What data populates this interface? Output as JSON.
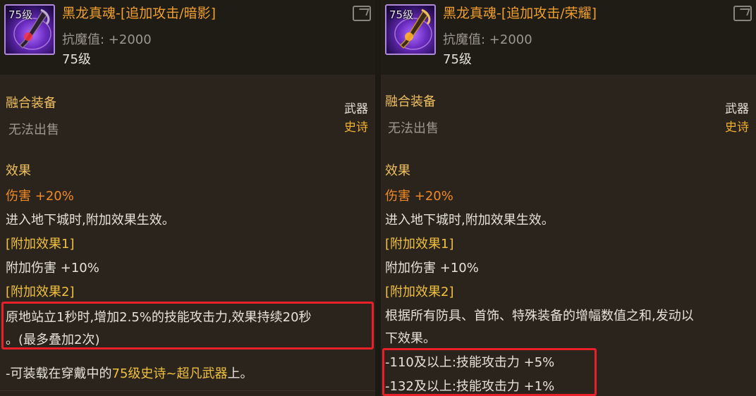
{
  "colors": {
    "accent_orange": "#f0a030",
    "red_highlight": "#e8202a",
    "epic_gold": "#f0b030"
  },
  "left": {
    "icon_level_tag": "75级",
    "item_name": "黑龙真魂-[追加攻击/暗影]",
    "stat": "抗魔值: +2000",
    "level": "75级",
    "category": "融合装备",
    "sell_status": "无法出售",
    "slot": "武器",
    "grade": "史诗",
    "effect_title": "效果",
    "damage_label": "伤害",
    "damage_value": "+20%",
    "dungeon_note": "进入地下城时,附加效果生效。",
    "bonus1_title": "[附加效果1]",
    "bonus1_label": "附加伤害",
    "bonus1_value": "+10%",
    "bonus2_title": "[附加效果2]",
    "bonus2_line1": "原地站立1秒时,增加2.5%的技能攻击力,效果持续20秒",
    "bonus2_line2": "。(最多叠加2次)",
    "equip_prefix": "-可装载在穿戴中的",
    "equip_highlight": "75级史诗~超凡武器",
    "equip_suffix": "上。"
  },
  "right": {
    "icon_level_tag": "75级",
    "item_name": "黑龙真魂-[追加攻击/荣耀]",
    "stat": "抗魔值: +2000",
    "level": "75级",
    "category": "融合装备",
    "sell_status": "无法出售",
    "slot": "武器",
    "grade": "史诗",
    "effect_title": "效果",
    "damage_label": "伤害",
    "damage_value": "+20%",
    "dungeon_note": "进入地下城时,附加效果生效。",
    "bonus1_title": "[附加效果1]",
    "bonus1_label": "附加伤害",
    "bonus1_value": "+10%",
    "bonus2_title": "[附加效果2]",
    "bonus2_line1": "根据所有防具、首饰、特殊装备的增幅数值之和,发动以",
    "bonus2_line2": "下效果。",
    "tier1": "-110及以上:技能攻击力 +5%",
    "tier2": "-132及以上:技能攻击力 +1%"
  }
}
